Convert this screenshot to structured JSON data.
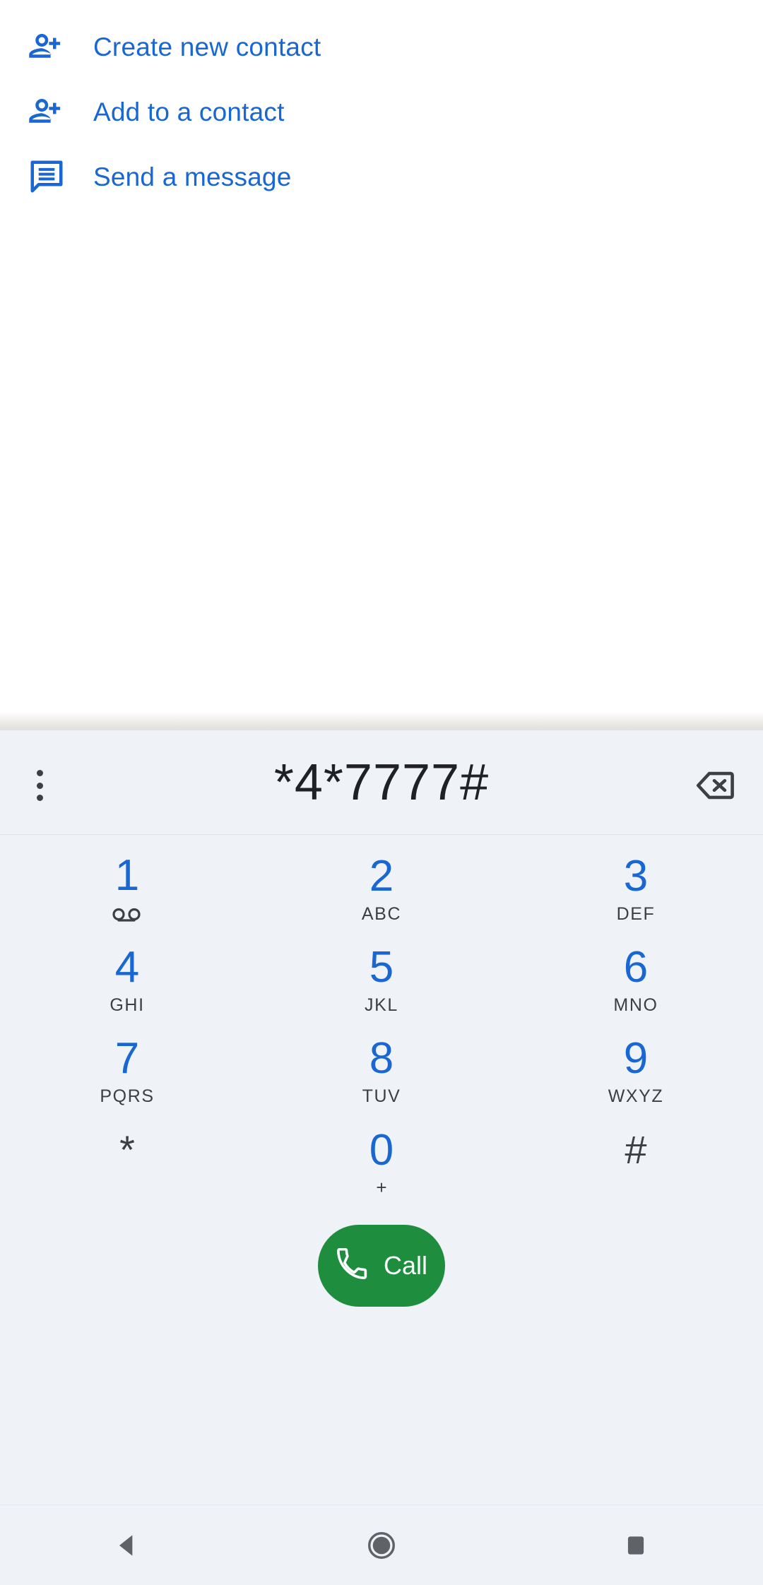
{
  "colors": {
    "accent_blue": "#1967d2",
    "call_green": "#1e8e3e",
    "dialpad_bg": "#eff2f7",
    "text_dark": "#3c4043",
    "digits_text": "#202124"
  },
  "suggestions": {
    "items": [
      {
        "label": "Create new contact",
        "icon": "person-add-icon"
      },
      {
        "label": "Add to a contact",
        "icon": "person-add-icon"
      },
      {
        "label": "Send a message",
        "icon": "message-icon"
      }
    ]
  },
  "dialer": {
    "entered_number": "*4*7777#",
    "overflow_icon": "more-vert-icon",
    "backspace_icon": "backspace-icon",
    "keys": [
      {
        "digit": "1",
        "sub": "",
        "icon": "voicemail-icon",
        "style": "blue"
      },
      {
        "digit": "2",
        "sub": "ABC",
        "icon": "",
        "style": "blue"
      },
      {
        "digit": "3",
        "sub": "DEF",
        "icon": "",
        "style": "blue"
      },
      {
        "digit": "4",
        "sub": "GHI",
        "icon": "",
        "style": "blue"
      },
      {
        "digit": "5",
        "sub": "JKL",
        "icon": "",
        "style": "blue"
      },
      {
        "digit": "6",
        "sub": "MNO",
        "icon": "",
        "style": "blue"
      },
      {
        "digit": "7",
        "sub": "PQRS",
        "icon": "",
        "style": "blue"
      },
      {
        "digit": "8",
        "sub": "TUV",
        "icon": "",
        "style": "blue"
      },
      {
        "digit": "9",
        "sub": "WXYZ",
        "icon": "",
        "style": "blue"
      },
      {
        "digit": "*",
        "sub": "",
        "icon": "",
        "style": "dark"
      },
      {
        "digit": "0",
        "sub": "+",
        "icon": "",
        "style": "blue"
      },
      {
        "digit": "#",
        "sub": "",
        "icon": "",
        "style": "dark"
      }
    ],
    "call_button": {
      "label": "Call",
      "icon": "phone-icon"
    }
  },
  "navbar": {
    "back": "back-triangle-icon",
    "home": "home-circle-icon",
    "recents": "recents-square-icon"
  }
}
